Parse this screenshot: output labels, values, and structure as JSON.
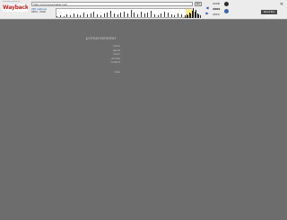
{
  "toolbar": {
    "logo_tagline": "INTERNET ARCHIVE",
    "logo_text": "WaybackMachine",
    "url_value": "http://primarsemeter.net/",
    "go_label": "Go",
    "captures_label": "298 captures",
    "captures_range": "2003 - 2016",
    "year_prev": "2008",
    "year_current": "2009",
    "year_next": "2010",
    "prev_arrow": "◀",
    "next_arrow": "▶",
    "close_label": "✕",
    "tools_label": "About this capture",
    "help_label": "?"
  },
  "site": {
    "title": "primarsemeter",
    "nav": [
      "home",
      "about",
      "music",
      "photos",
      "contact",
      "links"
    ]
  },
  "colors": {
    "page_bg": "#6d6d6d",
    "toolbar_bg": "#ececec",
    "link_blue": "#1a55b0",
    "highlight": "#ffe88a"
  }
}
